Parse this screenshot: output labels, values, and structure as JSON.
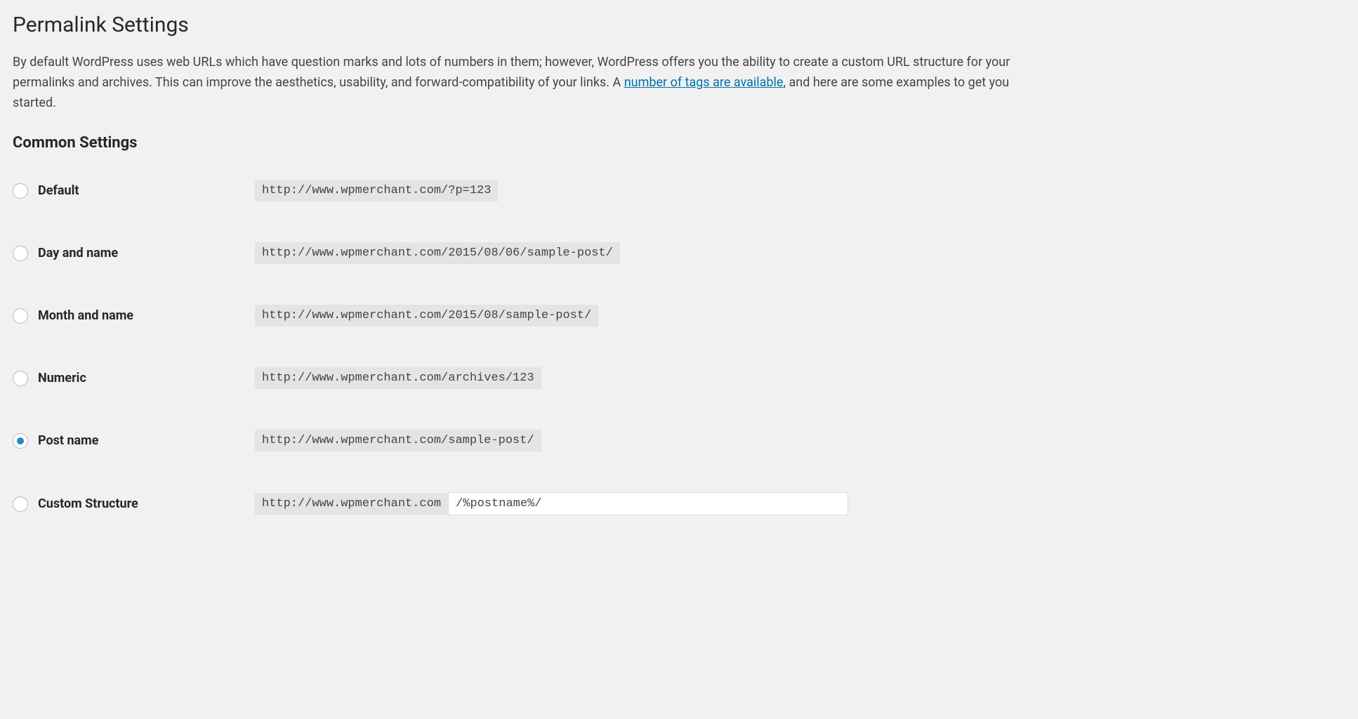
{
  "page": {
    "title": "Permalink Settings",
    "description_pre": "By default WordPress uses web URLs which have question marks and lots of numbers in them; however, WordPress offers you the ability to create a custom URL structure for your permalinks and archives. This can improve the aesthetics, usability, and forward-compatibility of your links. A ",
    "description_link": "number of tags are available",
    "description_post": ", and here are some examples to get you started."
  },
  "common_settings": {
    "heading": "Common Settings",
    "options": [
      {
        "label": "Default",
        "example": "http://www.wpmerchant.com/?p=123",
        "selected": false
      },
      {
        "label": "Day and name",
        "example": "http://www.wpmerchant.com/2015/08/06/sample-post/",
        "selected": false
      },
      {
        "label": "Month and name",
        "example": "http://www.wpmerchant.com/2015/08/sample-post/",
        "selected": false
      },
      {
        "label": "Numeric",
        "example": "http://www.wpmerchant.com/archives/123",
        "selected": false
      },
      {
        "label": "Post name",
        "example": "http://www.wpmerchant.com/sample-post/",
        "selected": true
      }
    ],
    "custom": {
      "label": "Custom Structure",
      "base": "http://www.wpmerchant.com",
      "input_value": "/%postname%/",
      "selected": false
    }
  }
}
